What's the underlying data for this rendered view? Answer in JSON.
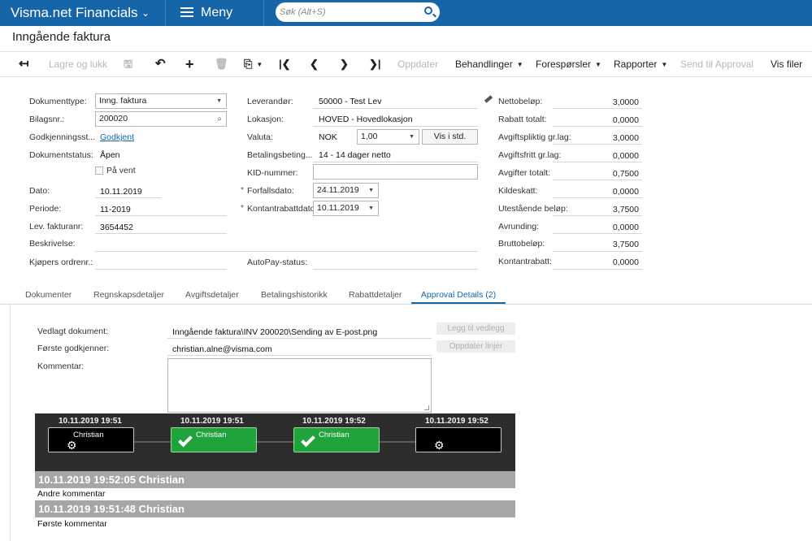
{
  "topbar": {
    "app_name": "Visma.net Financials",
    "menu_label": "Meny",
    "search_placeholder": "Søk (Alt+S)"
  },
  "page_title": "Inngående faktura",
  "toolbar": {
    "save_close": "Lagre og lukk",
    "update": "Oppdater",
    "actions": "Behandlinger",
    "inquiries": "Forespørsler",
    "reports": "Rapporter",
    "send_approval": "Send til Approval",
    "show_files": "Vis filer"
  },
  "form": {
    "col1": {
      "doc_type_label": "Dokumenttype:",
      "doc_type_value": "Inng. faktura",
      "ref_label": "Bilagsnr.:",
      "ref_value": "200020",
      "approval_label": "Godkjenningsst...",
      "approval_value": "Godkjent",
      "status_label": "Dokumentstatus:",
      "status_value": "Åpen",
      "hold_label": "På vent",
      "date_label": "Dato:",
      "date_value": "10.11.2019",
      "period_label": "Periode:",
      "period_value": "11-2019",
      "vendor_ref_label": "Lev. fakturanr:",
      "vendor_ref_value": "3654452",
      "description_label": "Beskrivelse:",
      "buyer_order_label": "Kjøpers ordrenr.:"
    },
    "col2": {
      "vendor_label": "Leverandør:",
      "vendor_value": "50000 - Test Lev",
      "location_label": "Lokasjon:",
      "location_value": "HOVED - Hovedlokasjon",
      "currency_label": "Valuta:",
      "currency_value": "NOK",
      "rate_value": "1,00",
      "view_base_button": "Vis i std.",
      "terms_label": "Betalingsbeting...",
      "terms_value": "14 - 14 dager netto",
      "kid_label": "KID-nummer:",
      "due_date_label": "Forfallsdato:",
      "due_date_value": "24.11.2019",
      "cash_disc_date_label": "Kontantrabattdato:",
      "cash_disc_date_value": "10.11.2019",
      "autopay_label": "AutoPay-status:"
    },
    "totals": [
      {
        "label": "Nettobeløp:",
        "value": "3,0000"
      },
      {
        "label": "Rabatt totalt:",
        "value": "0,0000"
      },
      {
        "label": "Avgiftspliktig gr.lag:",
        "value": "3,0000"
      },
      {
        "label": "Avgiftsfritt gr.lag:",
        "value": "0,0000"
      },
      {
        "label": "Avgifter totalt:",
        "value": "0,7500"
      },
      {
        "label": "Kildeskatt:",
        "value": "0,0000"
      },
      {
        "label": "Utestående beløp:",
        "value": "3,7500"
      },
      {
        "label": "Avrunding:",
        "value": "0,0000"
      },
      {
        "label": "Bruttobeløp:",
        "value": "3,7500"
      },
      {
        "label": "Kontantrabatt:",
        "value": "0,0000"
      }
    ]
  },
  "tabs": [
    "Dokumenter",
    "Regnskapsdetaljer",
    "Avgiftsdetaljer",
    "Betalingshistorikk",
    "Rabattdetaljer",
    "Approval Details (2)"
  ],
  "approval": {
    "attached_label": "Vedlagt dokument:",
    "attached_value": "Inngående faktura\\INV 200020\\Sending av E-post.png",
    "first_approver_label": "Første godkjenner:",
    "first_approver_value": "christian.alne@visma.com",
    "comment_label": "Kommentar:",
    "add_attachment_button": "Legg til vedlegg",
    "update_lines_button": "Oppdater linjer",
    "flow": [
      {
        "time": "10.11.2019 19:51",
        "name": "Christian",
        "state": "pending"
      },
      {
        "time": "10.11.2019 19:51",
        "name": "Christian",
        "state": "approved"
      },
      {
        "time": "10.11.2019 19:52",
        "name": "Christian",
        "state": "approved"
      },
      {
        "time": "10.11.2019 19:52",
        "name": "",
        "state": "pending"
      }
    ],
    "comments": [
      {
        "header": "10.11.2019 19:52:05 Christian",
        "text": "Andre kommentar"
      },
      {
        "header": "10.11.2019 19:51:48 Christian",
        "text": "Første kommentar"
      }
    ]
  }
}
